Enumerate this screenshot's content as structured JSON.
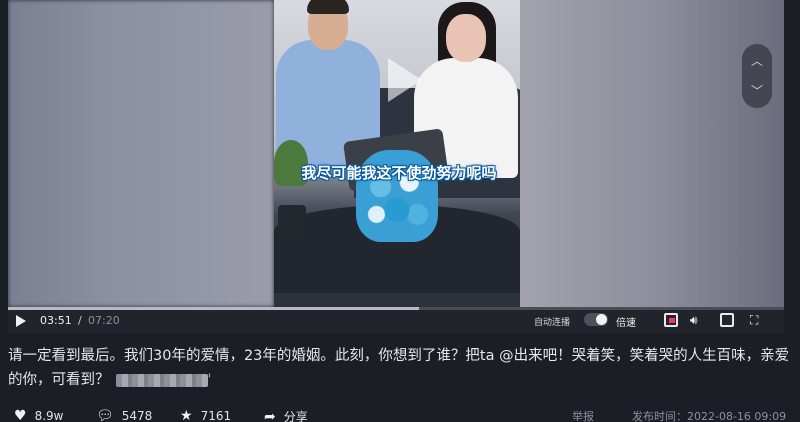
{
  "video": {
    "caption": "我尽可能我这不使劲努力呢吗",
    "progress_fraction": 0.53
  },
  "controls": {
    "current_time": "03:51",
    "separator": "/",
    "total_time": "07:20",
    "autoplay_label": "自动连播",
    "speed_label": "倍速"
  },
  "nav": {
    "up_icon": "chevron-up-icon",
    "down_icon": "chevron-down-icon"
  },
  "description": {
    "text": "请一定看到最后。我们30年的爱情，23年的婚姻。此刻，你想到了谁？把ta @出来吧！哭着笑，笑着哭的人生百味，亲爱的你，可看到？",
    "tail": "'"
  },
  "stats": {
    "likes": "8.9w",
    "comments": "5478",
    "favorites": "7161",
    "share_label": "分享"
  },
  "meta": {
    "report_label": "举报",
    "publish_label": "发布时间：2022-08-16 09:09"
  },
  "colors": {
    "background": "#1c1e26",
    "accent_pip": "#ff3355",
    "caption_outline": "#0a5aa0"
  }
}
